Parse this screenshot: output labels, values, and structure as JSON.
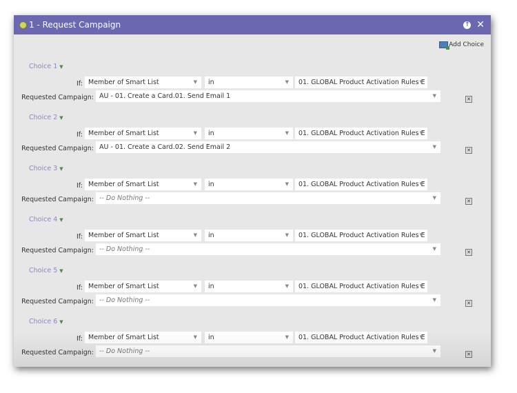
{
  "dialog": {
    "title": "1 - Request Campaign",
    "add_choice": "Add Choice"
  },
  "labels": {
    "if": "If:",
    "requested": "Requested Campaign:"
  },
  "choices": [
    {
      "label": "Choice 1",
      "field": "Member of Smart List",
      "operator": "in",
      "value": "01. GLOBAL Product Activation Rules E",
      "campaign": "AU - 01. Create a Card.01. Send Email 1",
      "empty": false
    },
    {
      "label": "Choice 2",
      "field": "Member of Smart List",
      "operator": "in",
      "value": "01. GLOBAL Product Activation Rules E",
      "campaign": "AU - 01. Create a Card.02. Send Email 2",
      "empty": false
    },
    {
      "label": "Choice 3",
      "field": "Member of Smart List",
      "operator": "in",
      "value": "01. GLOBAL Product Activation Rules E",
      "campaign": "-- Do Nothing --",
      "empty": true
    },
    {
      "label": "Choice 4",
      "field": "Member of Smart List",
      "operator": "in",
      "value": "01. GLOBAL Product Activation Rules E",
      "campaign": "-- Do Nothing --",
      "empty": true
    },
    {
      "label": "Choice 5",
      "field": "Member of Smart List",
      "operator": "in",
      "value": "01. GLOBAL Product Activation Rules E",
      "campaign": "-- Do Nothing --",
      "empty": true
    },
    {
      "label": "Choice 6",
      "field": "Member of Smart List",
      "operator": "in",
      "value": "01. GLOBAL Product Activation Rules E",
      "campaign": "-- Do Nothing --",
      "empty": true
    }
  ]
}
